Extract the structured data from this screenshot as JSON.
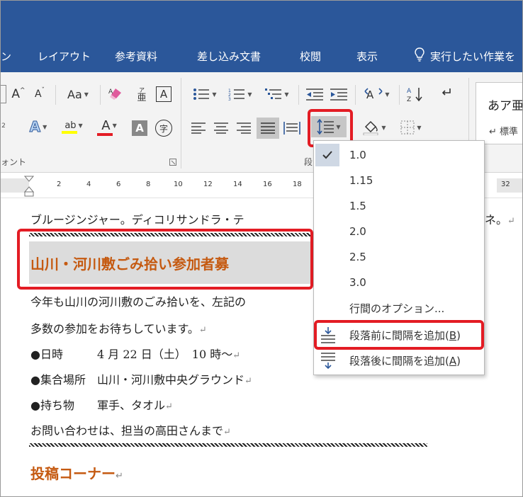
{
  "ribbon_tabs": [
    "ン",
    "レイアウト",
    "参考資料",
    "差し込み文書",
    "校閲",
    "表示"
  ],
  "tell_me": "実行したい作業を",
  "font_group": {
    "label": "ォント",
    "case_button": "Aa",
    "grow_font": "A",
    "shrink_font": "A",
    "phonetic_glyph": "亜",
    "border_glyph": "A",
    "text_effects_glyph": "A",
    "highlight_glyph": "ab",
    "font_color_glyph": "A",
    "shading_glyph": "A",
    "enclose_glyph": "字",
    "superscript_hint": "2",
    "highlight_color": "#ffff00",
    "font_color": "#e31c24"
  },
  "paragraph_group": {
    "label": "段"
  },
  "styles_group": {
    "style_preview": "あア亜",
    "style_name": "↵ 標準"
  },
  "ruler": {
    "ticks": [
      "2",
      "4",
      "6",
      "8",
      "10",
      "12",
      "14",
      "16",
      "18",
      "32"
    ]
  },
  "document": {
    "line1": "ブルージンジャー。ディコリサンドラ・テ",
    "line1_tail": "ネ。",
    "heading": "山川・河川敷ごみ拾い参加者募",
    "lines": [
      "今年も山川の河川敷のごみ拾いを、左記の",
      "多数の参加をお待ちしています。",
      "●日時　　　4 月 22 日（土）　10 時～",
      "●集合場所　山川・河川敷中央グラウンド",
      "●持ち物　　軍手、タオル",
      "お問い合わせは、担当の高田さんまで"
    ],
    "heading2": "投稿コーナー",
    "paragraph_mark": "↵",
    "heading_color": "#c55a11"
  },
  "line_spacing_menu": {
    "options": [
      "1.0",
      "1.15",
      "1.5",
      "2.0",
      "2.5",
      "3.0"
    ],
    "selected": "1.0",
    "spacing_options": "行間のオプション...",
    "add_before_prefix": "段落前に間隔を追加(",
    "add_before_key": "B",
    "add_after_prefix": "段落後に間隔を追加(",
    "add_after_key": "A",
    "close_paren": ")"
  },
  "colors": {
    "ribbon_blue": "#2b579a",
    "callout_red": "#e31c24"
  }
}
